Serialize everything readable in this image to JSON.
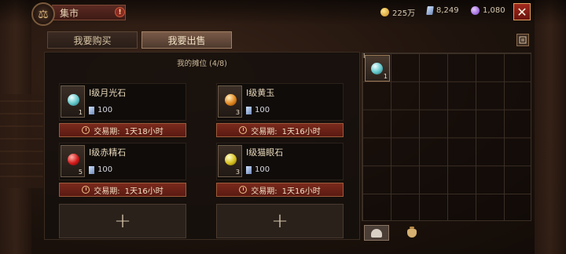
{
  "header": {
    "title": "集市",
    "info_icon": "!",
    "emblem_icon": "scales-icon",
    "currencies": [
      {
        "name": "gold",
        "icon": "gold-coin-icon",
        "value": "225万"
      },
      {
        "name": "crystal",
        "icon": "crystal-icon",
        "value": "8,249"
      },
      {
        "name": "orb",
        "icon": "purple-orb-icon",
        "value": "1,080"
      }
    ],
    "close_icon": "✕"
  },
  "tabs": [
    {
      "label": "我要购买",
      "active": false
    },
    {
      "label": "我要出售",
      "active": true
    }
  ],
  "stall": {
    "title": "我的摊位 (4/8)",
    "listings": [
      {
        "name": "I级月光石",
        "qty": "1",
        "price": "100",
        "gem": "cyan",
        "period_label": "交易期:",
        "period_value": "1天18小时"
      },
      {
        "name": "I级黄玉",
        "qty": "3",
        "price": "100",
        "gem": "orange",
        "period_label": "交易期:",
        "period_value": "1天16小时"
      },
      {
        "name": "I级赤精石",
        "qty": "5",
        "price": "100",
        "gem": "red",
        "period_label": "交易期:",
        "period_value": "1天16小时"
      },
      {
        "name": "I级猫眼石",
        "qty": "3",
        "price": "100",
        "gem": "yellow",
        "period_label": "交易期:",
        "period_value": "1天16小时"
      }
    ],
    "empty_slots": [
      "+",
      "+"
    ]
  },
  "inventory": {
    "items": [
      {
        "gem": "cyan",
        "qty": "1",
        "mark": "I"
      }
    ],
    "bottom_tabs": [
      {
        "icon": "helmet-icon",
        "active": true
      },
      {
        "icon": "bag-icon",
        "active": false
      }
    ]
  },
  "colors": {
    "accent_red": "#7a2a1c",
    "panel_bg": "#16100d",
    "text_gold": "#eadbbd"
  }
}
